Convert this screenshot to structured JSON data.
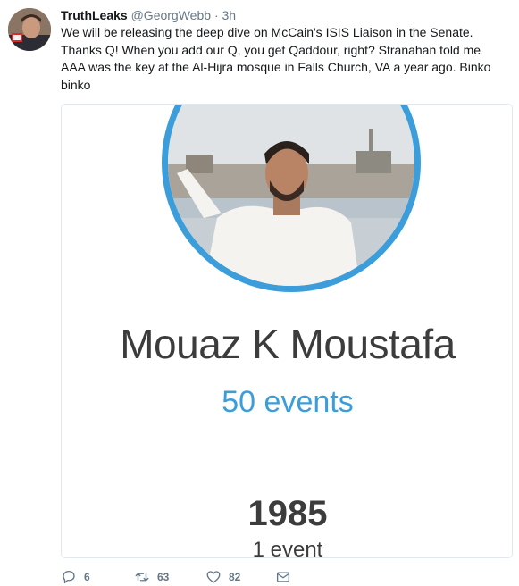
{
  "tweet": {
    "display_name": "TruthLeaks",
    "handle": "@GeorgWebb",
    "separator": "·",
    "time": "3h",
    "text": "We will be releasing the deep dive on McCain's ISIS Liaison in the Senate. Thanks Q!  When you add our Q, you get Qaddour, right?  Stranahan told me AAA was the key at the Al-Hijra mosque in Falls Church, VA a year ago. Binko binko"
  },
  "card": {
    "name": "Mouaz K Moustafa",
    "events": "50 events",
    "year": "1985",
    "year_events": "1 event",
    "accent_color": "#3b9edb"
  },
  "actions": {
    "reply_icon": "reply-icon",
    "reply_count": "6",
    "retweet_icon": "retweet-icon",
    "retweet_count": "63",
    "like_icon": "heart-icon",
    "like_count": "82",
    "dm_icon": "envelope-icon"
  }
}
